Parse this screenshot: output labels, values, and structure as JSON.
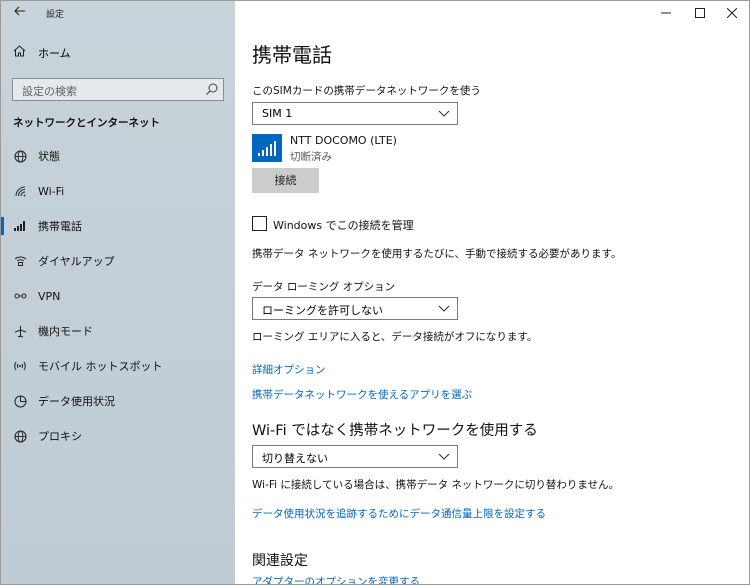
{
  "window": {
    "title": "設定"
  },
  "sidebar": {
    "home_label": "ホーム",
    "search_placeholder": "設定の検索",
    "section_title": "ネットワークとインターネット",
    "items": [
      {
        "label": "状態",
        "icon": "globe-icon"
      },
      {
        "label": "Wi-Fi",
        "icon": "wifi-icon"
      },
      {
        "label": "携帯電話",
        "icon": "cellular-icon",
        "active": true
      },
      {
        "label": "ダイヤルアップ",
        "icon": "dialup-icon"
      },
      {
        "label": "VPN",
        "icon": "vpn-icon"
      },
      {
        "label": "機内モード",
        "icon": "airplane-icon"
      },
      {
        "label": "モバイル ホットスポット",
        "icon": "hotspot-icon"
      },
      {
        "label": "データ使用状況",
        "icon": "data-usage-icon"
      },
      {
        "label": "プロキシ",
        "icon": "proxy-icon"
      }
    ]
  },
  "main": {
    "title": "携帯電話",
    "sim_label": "このSIMカードの携帯データネットワークを使う",
    "sim_value": "SIM 1",
    "network_name": "NTT DOCOMO (LTE)",
    "network_status": "切断済み",
    "connect_button": "接続",
    "manage_checkbox_label": "Windows でこの接続を管理",
    "manage_checkbox_checked": false,
    "manage_desc": "携帯データ ネットワークを使用するたびに、手動で接続する必要があります。",
    "roaming_label": "データ ローミング オプション",
    "roaming_value": "ローミングを許可しない",
    "roaming_desc": "ローミング エリアに入ると、データ接続がオフになります。",
    "advanced_link": "詳細オプション",
    "apps_link": "携帯データネットワークを使えるアプリを選ぶ",
    "wifi_heading": "Wi-Fi ではなく携帯ネットワークを使用する",
    "wifi_value": "切り替えない",
    "wifi_desc": "Wi-Fi に接続している場合は、携帯データ ネットワークに切り替わりません。",
    "data_limit_link": "データ使用状況を追跡するためにデータ通信量上限を設定する",
    "related_heading": "関連設定",
    "adapter_link": "アダプターのオプションを変更する"
  },
  "colors": {
    "accent": "#0067c0",
    "sidebar_bg": "#c4cfd7"
  }
}
